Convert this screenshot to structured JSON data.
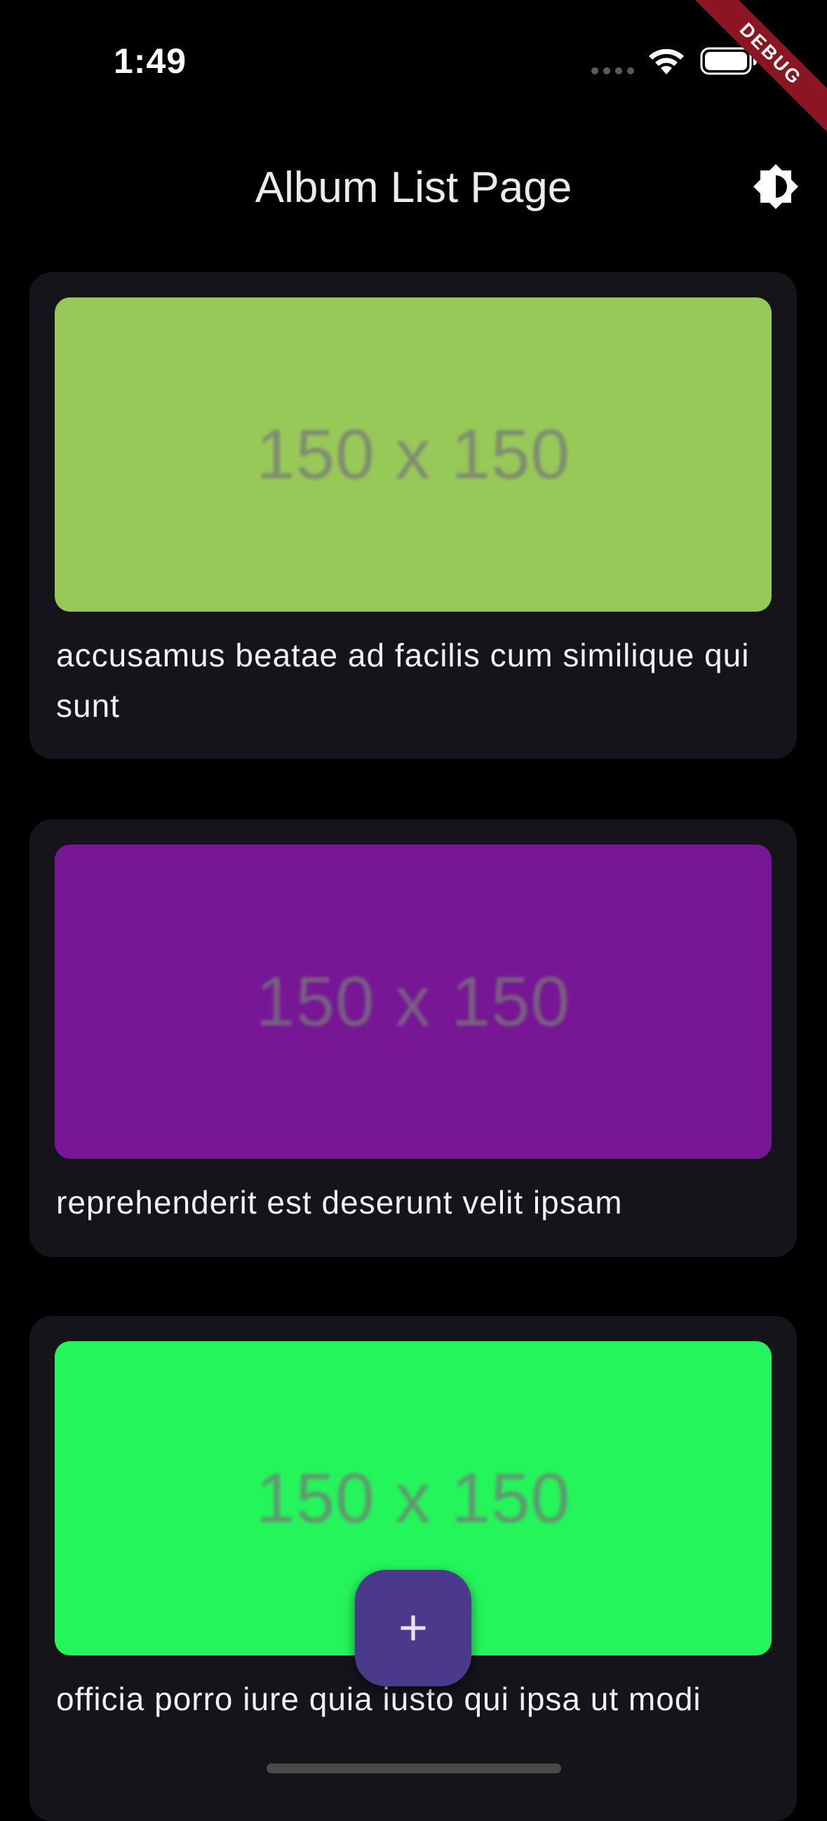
{
  "status_bar": {
    "time": "1:49",
    "icons": [
      "signal-dots-icon",
      "wifi-icon",
      "battery-icon"
    ]
  },
  "debug_banner": "DEBUG",
  "app_bar": {
    "title": "Album List Page",
    "theme_icon": "brightness-icon"
  },
  "albums": [
    {
      "thumbnail_text": "150 x 150",
      "thumbnail_color": "#97c958",
      "title": "accusamus beatae ad facilis cum similique qui sunt"
    },
    {
      "thumbnail_text": "150 x 150",
      "thumbnail_color": "#771796",
      "title": "reprehenderit est deserunt velit ipsam"
    },
    {
      "thumbnail_text": "150 x 150",
      "thumbnail_color": "#24f55a",
      "title": "officia porro iure quia iusto qui ipsa ut modi"
    }
  ],
  "fab": {
    "icon": "plus-icon",
    "label": "+"
  },
  "colors": {
    "background": "#000000",
    "card": "#16141b",
    "fab": "#4b3a8c",
    "debug_ribbon": "#8b1520"
  }
}
